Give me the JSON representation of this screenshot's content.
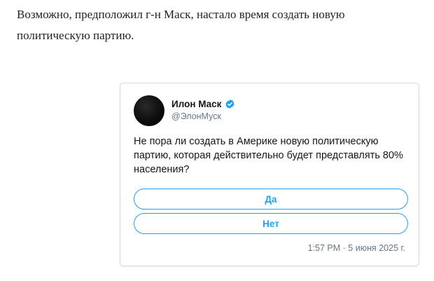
{
  "article": {
    "paragraph": "Возможно, предположил г-н Маск, настало время создать новую политическую партию."
  },
  "tweet": {
    "author": {
      "display_name": "Илон Маск",
      "handle": "@ЭлонМуск",
      "verified": true,
      "verified_icon": "verified-badge-icon",
      "avatar_icon": "avatar"
    },
    "text": "Не пора ли создать в Америке новую политическую партию, которая действительно будет представлять 80% населения?",
    "poll": {
      "options": [
        "Да",
        "Нет"
      ]
    },
    "timestamp": "1:57 PM · 5 июня 2025 г."
  },
  "colors": {
    "accent": "#1da1f2",
    "card_border": "#d6d9db",
    "secondary_text": "#657786",
    "primary_text": "#14171a"
  }
}
